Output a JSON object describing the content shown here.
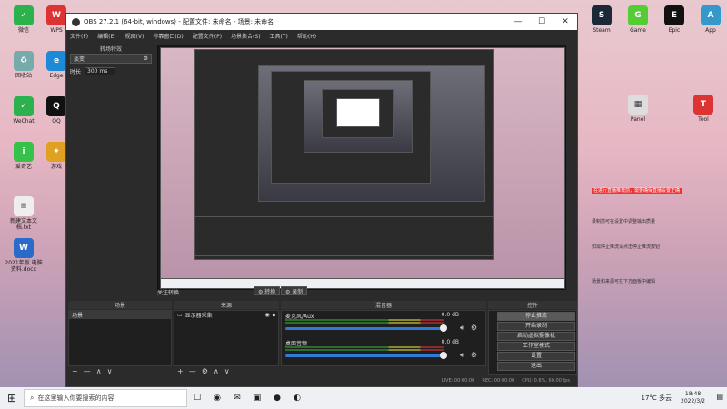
{
  "window": {
    "title": "OBS 27.2.1 (64-bit, windows) - 配置文件: 未命名 - 场景: 未命名",
    "minimize": "—",
    "maximize": "☐",
    "close": "✕"
  },
  "menu": [
    "文件(F)",
    "编辑(E)",
    "视图(V)",
    "停靠窗口(D)",
    "配置文件(P)",
    "场景集合(S)",
    "工具(T)",
    "帮助(H)"
  ],
  "filters": {
    "title": "转场特效",
    "effect": "淡变",
    "gear": "⚙",
    "duration_label": "时长",
    "duration_value": "300 ms"
  },
  "transition": {
    "label": "关注转换",
    "btn1": "⚙ 转换",
    "btn2": "⚙ 录制"
  },
  "docks": {
    "scenes": {
      "title": "场景",
      "items": [
        "场景"
      ]
    },
    "sources": {
      "title": "来源",
      "items": [
        "显示器采集"
      ]
    },
    "mixer": {
      "title": "混音器",
      "channels": [
        {
          "name": "麦克风/Aux",
          "db": "0.0 dB",
          "level": 1.0
        },
        {
          "name": "桌面音频",
          "db": "0.0 dB",
          "level": 1.0
        }
      ]
    },
    "controls": {
      "title": "控件",
      "buttons": [
        "停止推流",
        "开始录制",
        "启动虚拟摄像机",
        "工作室模式",
        "设置",
        "退出"
      ]
    }
  },
  "footer_icons": {
    "add": "+",
    "remove": "—",
    "up": "∧",
    "down": "∨",
    "gear": "⚙"
  },
  "status": {
    "live": "LIVE: 00:00:00",
    "rec": "REC: 00:00:00",
    "cpu": "CPU: 0.6%, 60.00 fps"
  },
  "desktop_left": [
    {
      "label": "微信",
      "color": "#2bb24c"
    },
    {
      "label": "WPS",
      "color": "#d33"
    },
    {
      "label": "回收站",
      "color": "#7aa"
    },
    {
      "label": "Edge",
      "color": "#1c8ad6"
    },
    {
      "label": "QQ",
      "color": "#111"
    },
    {
      "label": "WeChat",
      "color": "#2bb24c"
    },
    {
      "label": "爱奇艺",
      "color": "#36c24a"
    },
    {
      "label": "游戏",
      "color": "#e0a020"
    },
    {
      "label": "新建文本文档.txt",
      "color": "#eee"
    },
    {
      "label": "2021年版 电脑资料.docx",
      "color": "#2a6ac8"
    }
  ],
  "desktop_right": [
    {
      "label": "Steam",
      "color": "#1b2838"
    },
    {
      "label": "Game",
      "color": "#5c3"
    },
    {
      "label": "Epic",
      "color": "#111"
    },
    {
      "label": "App",
      "color": "#39c"
    },
    {
      "label": "Panel",
      "color": "#ddd"
    },
    {
      "label": "Tool",
      "color": "#d33"
    }
  ],
  "annotations": [
    "在进行直播推流前，需要确保直播设置正确",
    "录制前可在设置中调整输出质量",
    "如需停止推流请点击停止推流按钮",
    "场景和来源可在下方面板中编辑"
  ],
  "taskbar": {
    "start": "⊞",
    "search_placeholder": "在这里输入你要搜索的内容",
    "icons": [
      "☐",
      "◉",
      "✉",
      "▣",
      "●",
      "◐"
    ],
    "weather": "17°C 多云",
    "time": "18:48",
    "date": "2022/3/2",
    "notify": "▤"
  }
}
